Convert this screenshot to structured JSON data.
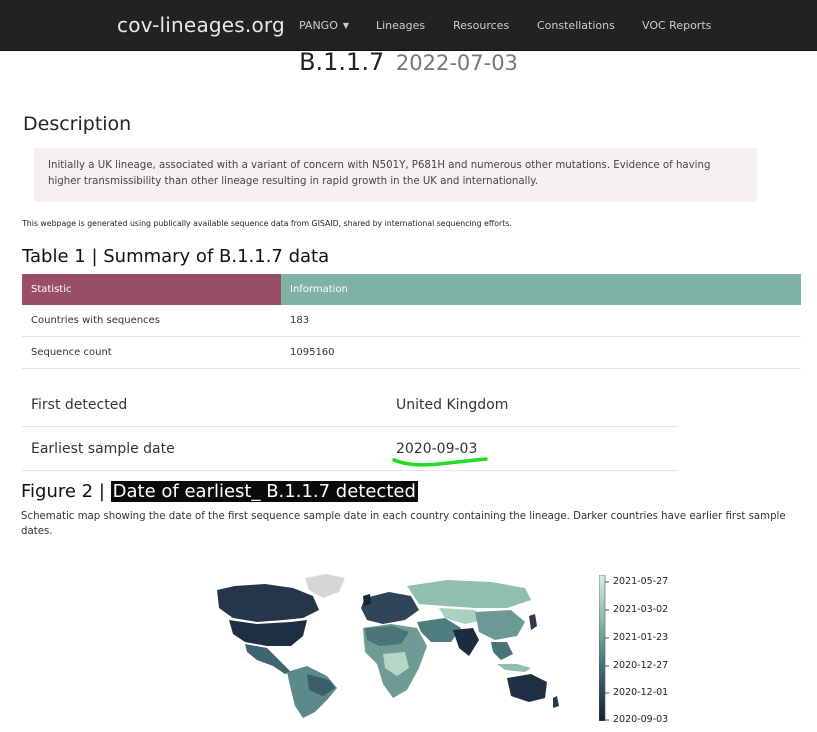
{
  "navbar": {
    "brand": "cov-lineages.org",
    "items": [
      "PANGO",
      "Lineages",
      "Resources",
      "Constellations",
      "VOC Reports"
    ],
    "dropdown_caret": "caret-down-icon"
  },
  "header": {
    "lineage": "B.1.1.7",
    "date": "2022-07-03"
  },
  "description": {
    "heading": "Description",
    "text": "Initially a UK lineage, associated with a variant of concern with N501Y, P681H and numerous other mutations. Evidence of having higher transmissibility than other lineage resulting in rapid growth in the UK and internationally."
  },
  "note": "This webpage is generated using publically available sequence data from GISAID, shared by international sequencing efforts.",
  "table1": {
    "title": "Table 1 | Summary of B.1.1.7 data",
    "headers": [
      "Statistic",
      "Information"
    ],
    "rows": [
      [
        "Countries with sequences",
        "183"
      ],
      [
        "Sequence count",
        "1095160"
      ]
    ]
  },
  "table2": {
    "rows": [
      [
        "First detected",
        "United Kingdom"
      ],
      [
        "Earliest sample date",
        "2020-09-03"
      ]
    ]
  },
  "figure2": {
    "title_prefix": "Figure 2 |",
    "title_highlight": "Date of earliest_ B.1.1.7 detected",
    "caption": "Schematic map showing the date of the first sequence sample date in each country containing the lineage. Darker countries have earlier first sample dates.",
    "colorbar_labels": [
      "2021-05-27",
      "2021-03-02",
      "2021-01-23",
      "2020-12-27",
      "2020-12-01",
      "2020-09-03"
    ]
  },
  "colors": {
    "navbar": "#222222",
    "statistic_header": "#9a4d66",
    "information_header": "#7fb2a4",
    "description_bg": "#f7f0f1",
    "annotation_underline": "#22dd22",
    "map_dark": "#2b3a4a",
    "map_light": "#c6e3d4"
  }
}
